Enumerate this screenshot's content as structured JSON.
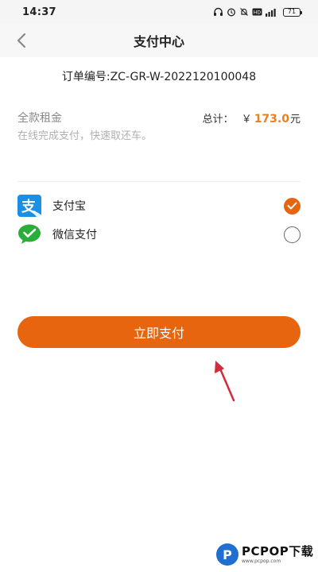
{
  "status_bar": {
    "time": "14:37",
    "battery": "71"
  },
  "nav": {
    "title": "支付中心"
  },
  "order": {
    "number_text": "订单编号:ZC-GR-W-2022120100048"
  },
  "rent": {
    "label": "全款租金",
    "total_label": "总计：",
    "currency": "￥",
    "amount": "173.0",
    "unit": "元",
    "tip": "在线完成支付，快速取还车。"
  },
  "payment_methods": [
    {
      "label": "支付宝",
      "icon": "alipay-icon",
      "selected": true
    },
    {
      "label": "微信支付",
      "icon": "wechat-pay-icon",
      "selected": false
    }
  ],
  "pay_button": {
    "label": "立即支付"
  },
  "watermark": {
    "text": "PCPOP下载",
    "sub": "www.pcpop.com"
  },
  "colors": {
    "accent": "#e8650f",
    "amount": "#e8801f",
    "alipay": "#1a8fe3",
    "wechat": "#2aae3a",
    "annotation_arrow": "#d42a3c"
  }
}
